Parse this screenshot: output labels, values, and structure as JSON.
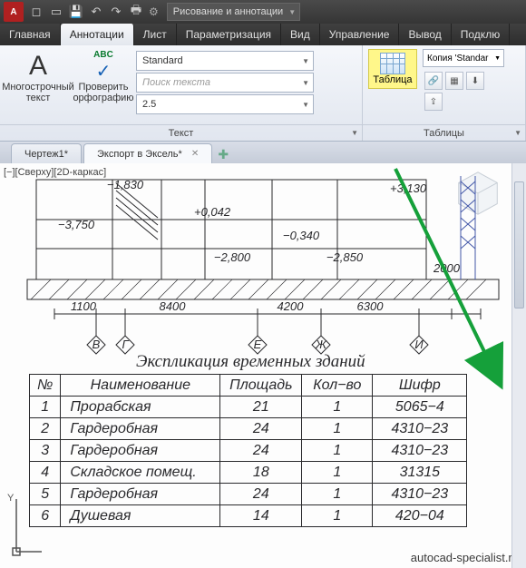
{
  "qat": {
    "workspace": "Рисование и аннотации"
  },
  "menu": {
    "items": [
      "Главная",
      "Аннотации",
      "Лист",
      "Параметризация",
      "Вид",
      "Управление",
      "Вывод",
      "Подклю"
    ],
    "active": 1
  },
  "ribbon": {
    "text": {
      "mtext_label": "Многострочный\nтекст",
      "abc": "ABC",
      "spell_label": "Проверить\nорфографию",
      "style": "Standard",
      "search_placeholder": "Поиск текста",
      "height": "2.5",
      "panel_title": "Текст"
    },
    "tables": {
      "btn": "Таблица",
      "style": "Копия 'Standar",
      "panel_title": "Таблицы"
    }
  },
  "docs": {
    "tabs": [
      "Чертеж1*",
      "Экспорт в Эксель*"
    ],
    "active": 1
  },
  "view_label": "[−][Сверху][2D-каркас]",
  "drawing": {
    "elevs": [
      "+3,130",
      "+0,042",
      "−0,340",
      "−2,800",
      "−2,850",
      "−3,750",
      "−1,830"
    ],
    "dims": [
      "1100",
      "8400",
      "4200",
      "6300",
      "2000"
    ],
    "axes": [
      "В",
      "Г",
      "Е",
      "Ж",
      "И"
    ]
  },
  "table": {
    "title": "Экспликация временных зданий",
    "headers": {
      "no": "№",
      "name": "Наименование",
      "area": "Площадь",
      "qty": "Кол−во",
      "code": "Шифр"
    },
    "rows": [
      {
        "no": "1",
        "name": "Прорабская",
        "area": "21",
        "qty": "1",
        "code": "5065−4"
      },
      {
        "no": "2",
        "name": "Гардеробная",
        "area": "24",
        "qty": "1",
        "code": "4310−23"
      },
      {
        "no": "3",
        "name": "Гардеробная",
        "area": "24",
        "qty": "1",
        "code": "4310−23"
      },
      {
        "no": "4",
        "name": "Складское помещ.",
        "area": "18",
        "qty": "1",
        "code": "31315"
      },
      {
        "no": "5",
        "name": "Гардеробная",
        "area": "24",
        "qty": "1",
        "code": "4310−23"
      },
      {
        "no": "6",
        "name": "Душевая",
        "area": "14",
        "qty": "1",
        "code": "420−04"
      }
    ]
  },
  "watermark": "autocad-specialist.ru"
}
